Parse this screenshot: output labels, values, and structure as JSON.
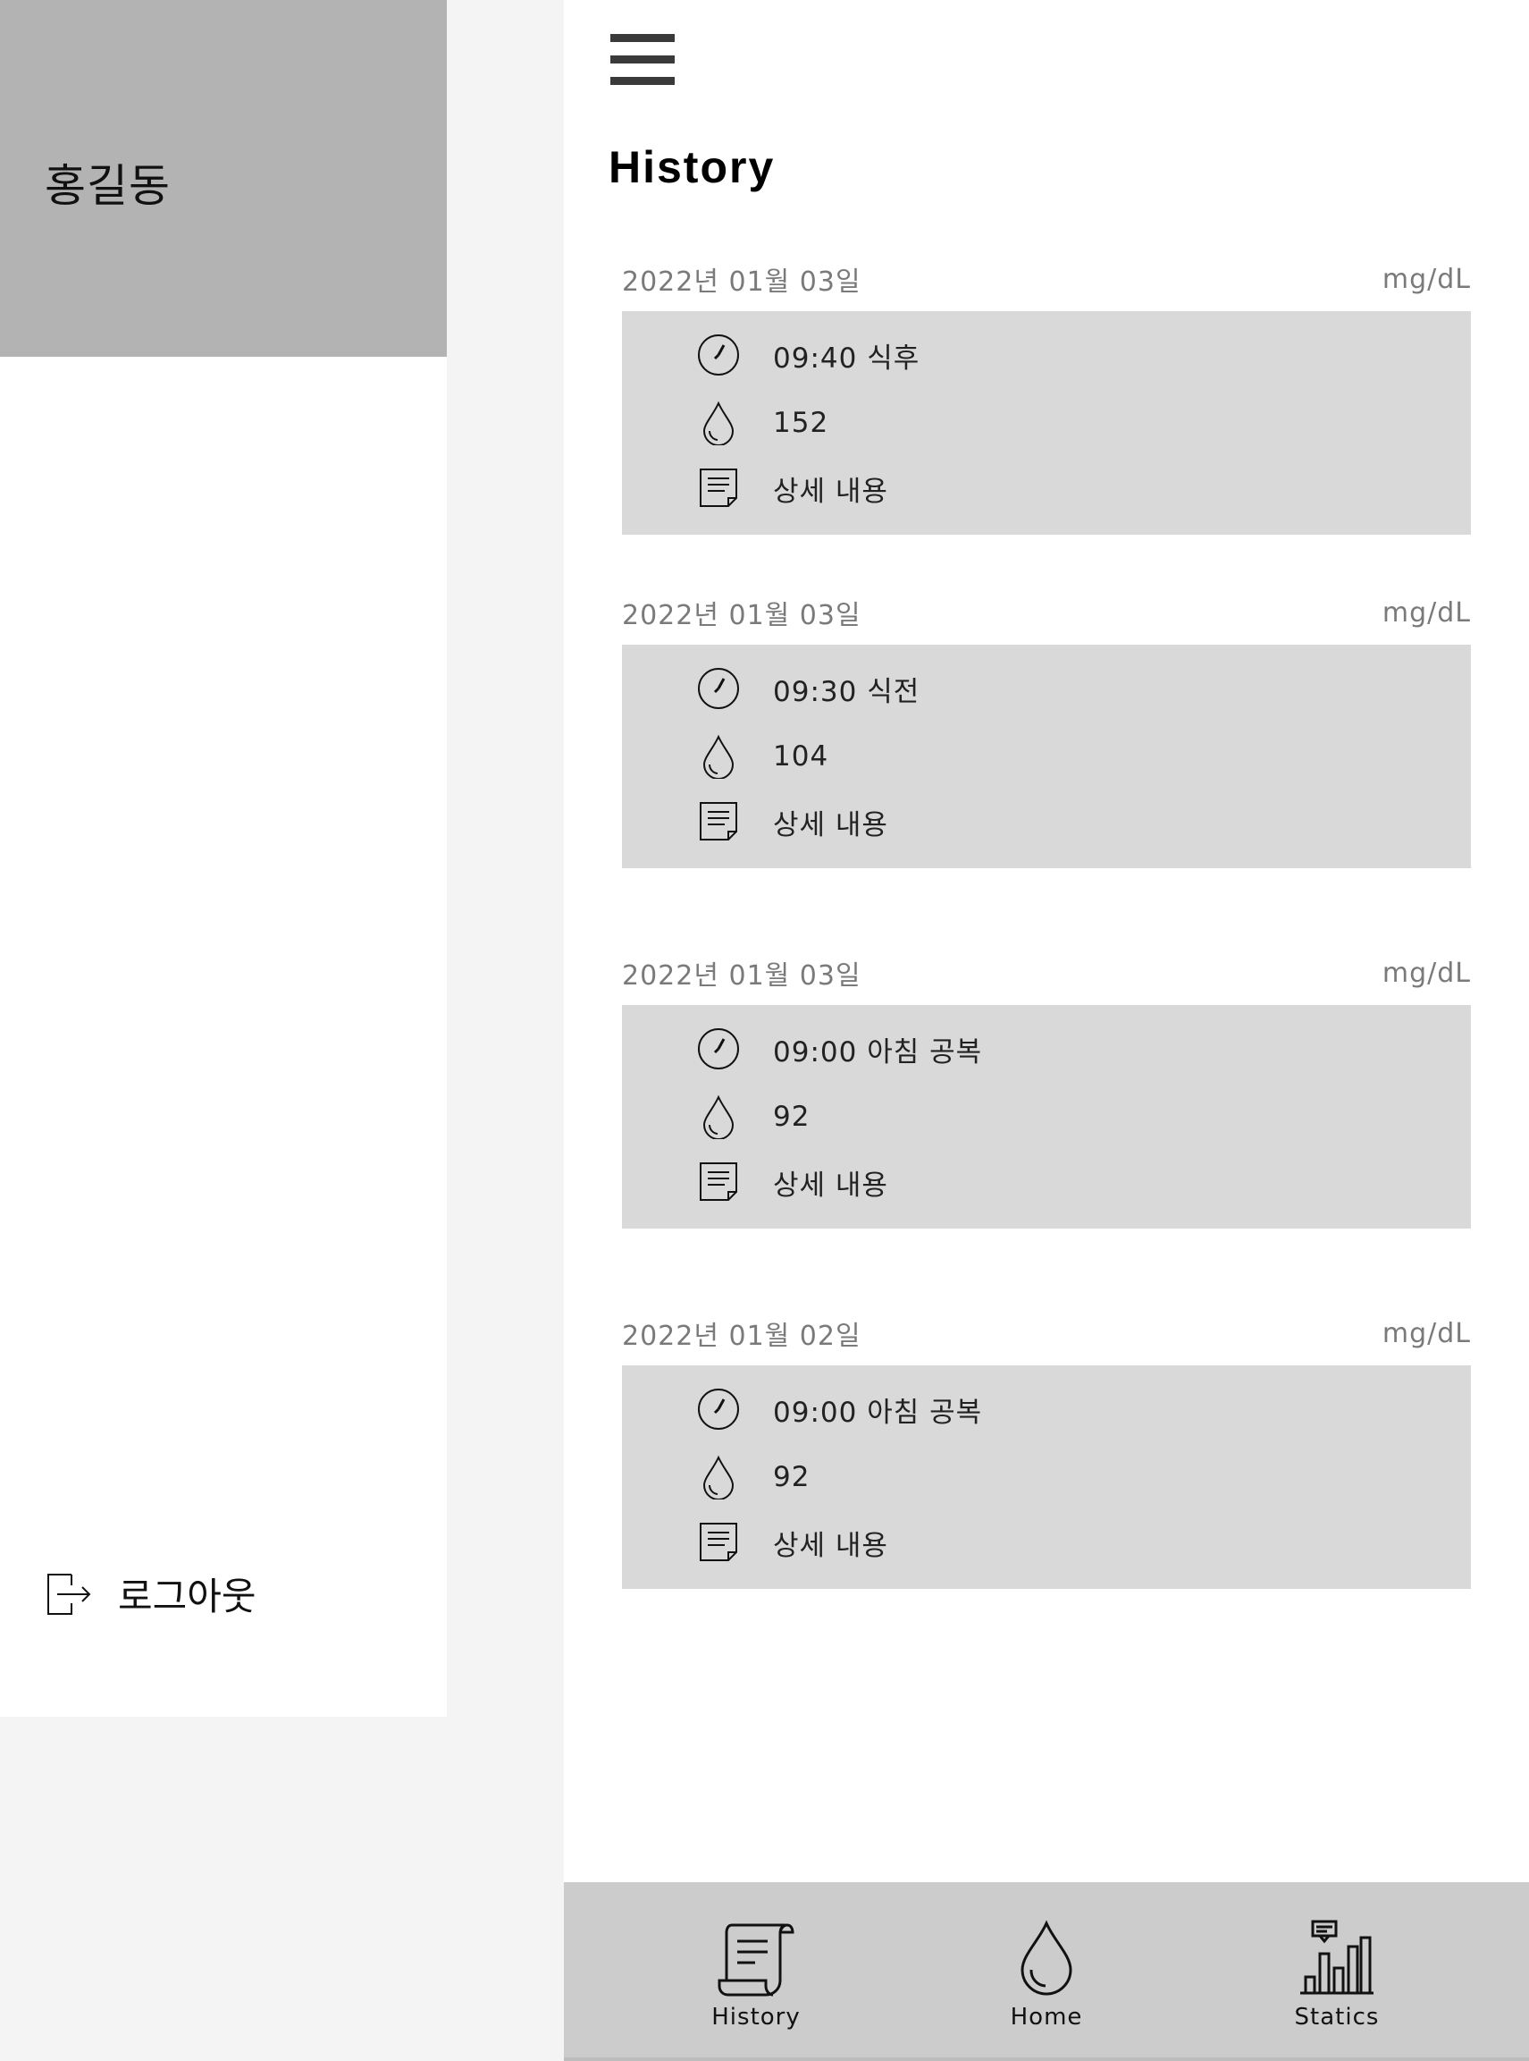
{
  "drawer": {
    "user_name": "홍길동",
    "logout_label": "로그아웃"
  },
  "header": {
    "title": "History"
  },
  "entries": [
    {
      "date": "2022년 01월 03일",
      "unit": "mg/dL",
      "time": "09:40 식후",
      "value": "152",
      "detail": "상세 내용"
    },
    {
      "date": "2022년 01월 03일",
      "unit": "mg/dL",
      "time": "09:30 식전",
      "value": "104",
      "detail": "상세 내용"
    },
    {
      "date": "2022년 01월 03일",
      "unit": "mg/dL",
      "time": "09:00 아침 공복",
      "value": "92",
      "detail": "상세 내용"
    },
    {
      "date": "2022년 01월 02일",
      "unit": "mg/dL",
      "time": "09:00 아침 공복",
      "value": "92",
      "detail": "상세 내용"
    }
  ],
  "bottom_nav": {
    "history_label": "History",
    "home_label": "Home",
    "statics_label": "Statics"
  },
  "icons": {
    "time": "clock-icon",
    "value": "drop-icon",
    "detail": "note-icon",
    "logout": "logout-icon",
    "menu": "hamburger-icon",
    "nav_history": "scroll-icon",
    "nav_home": "drop-icon",
    "nav_statics": "bar-chart-icon"
  },
  "colors": {
    "drawer_header": "#b3b3b3",
    "card_bg": "#d9d9d9",
    "nav_bg": "#cccccc",
    "page_bg": "#f4f4f4"
  }
}
